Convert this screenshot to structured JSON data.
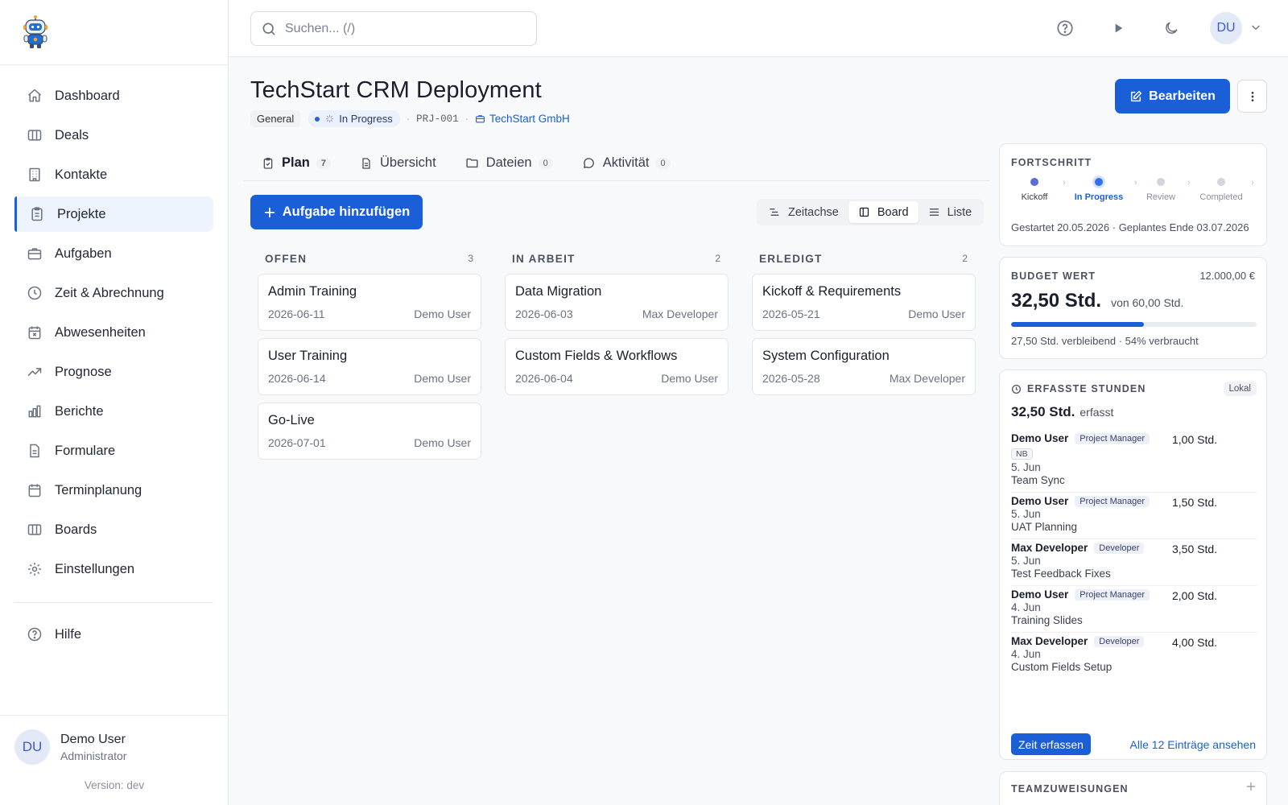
{
  "app": {
    "version_label": "Version: dev"
  },
  "sidebar": {
    "items": [
      {
        "label": "Dashboard",
        "icon": "home-icon"
      },
      {
        "label": "Deals",
        "icon": "columns-icon"
      },
      {
        "label": "Kontakte",
        "icon": "building-icon"
      },
      {
        "label": "Projekte",
        "icon": "clipboard-icon",
        "active": true
      },
      {
        "label": "Aufgaben",
        "icon": "briefcase-icon"
      },
      {
        "label": "Zeit & Abrechnung",
        "icon": "clock-icon"
      },
      {
        "label": "Abwesenheiten",
        "icon": "calendar-x-icon"
      },
      {
        "label": "Prognose",
        "icon": "trending-up-icon"
      },
      {
        "label": "Berichte",
        "icon": "bar-chart-icon"
      },
      {
        "label": "Formulare",
        "icon": "file-icon"
      },
      {
        "label": "Terminplanung",
        "icon": "calendar-icon"
      },
      {
        "label": "Boards",
        "icon": "columns-icon"
      },
      {
        "label": "Einstellungen",
        "icon": "gear-icon"
      }
    ],
    "help_label": "Hilfe",
    "user": {
      "initials": "DU",
      "name": "Demo User",
      "role": "Administrator"
    }
  },
  "topbar": {
    "search_placeholder": "Suchen... (/)",
    "avatar_initials": "DU"
  },
  "project": {
    "title": "TechStart CRM Deployment",
    "tag": "General",
    "status": "In Progress",
    "code": "PRJ-001",
    "company": "TechStart GmbH",
    "edit_label": "Bearbeiten"
  },
  "tabs": [
    {
      "label": "Plan",
      "count": "7",
      "active": true
    },
    {
      "label": "Übersicht",
      "count": ""
    },
    {
      "label": "Dateien",
      "count": "0"
    },
    {
      "label": "Aktivität",
      "count": "0"
    }
  ],
  "toolbar": {
    "add_label": "Aufgabe hinzufügen",
    "views": [
      {
        "label": "Zeitachse",
        "active": false
      },
      {
        "label": "Board",
        "active": true
      },
      {
        "label": "Liste",
        "active": false
      }
    ]
  },
  "board": {
    "columns": [
      {
        "title": "OFFEN",
        "count": "3",
        "cards": [
          {
            "title": "Admin Training",
            "date": "2026-06-11",
            "assignee": "Demo User"
          },
          {
            "title": "User Training",
            "date": "2026-06-14",
            "assignee": "Demo User"
          },
          {
            "title": "Go-Live",
            "date": "2026-07-01",
            "assignee": "Demo User"
          }
        ]
      },
      {
        "title": "IN ARBEIT",
        "count": "2",
        "cards": [
          {
            "title": "Data Migration",
            "date": "2026-06-03",
            "assignee": "Max Developer"
          },
          {
            "title": "Custom Fields & Workflows",
            "date": "2026-06-04",
            "assignee": "Demo User"
          }
        ]
      },
      {
        "title": "ERLEDIGT",
        "count": "2",
        "cards": [
          {
            "title": "Kickoff & Requirements",
            "date": "2026-05-21",
            "assignee": "Demo User"
          },
          {
            "title": "System Configuration",
            "date": "2026-05-28",
            "assignee": "Max Developer"
          }
        ]
      }
    ]
  },
  "progress": {
    "label": "FORTSCHRITT",
    "steps": [
      {
        "label": "Kickoff",
        "state": "done"
      },
      {
        "label": "In Progress",
        "state": "current"
      },
      {
        "label": "Review",
        "state": "todo"
      },
      {
        "label": "Completed",
        "state": "todo"
      }
    ],
    "dates": "Gestartet 20.05.2026 · Geplantes Ende 03.07.2026"
  },
  "budget": {
    "label": "BUDGET WERT",
    "amount": "12.000,00 €",
    "used": "32,50 Std.",
    "of": "von 60,00 Std.",
    "used_fraction": 0.54,
    "footer": "27,50 Std. verbleibend · 54% verbraucht"
  },
  "hours": {
    "label": "ERFASSTE STUNDEN",
    "badge": "Lokal",
    "total": "32,50 Std.",
    "total_suffix": "erfasst",
    "entries": [
      {
        "name": "Demo User",
        "role": "Project Manager",
        "hours": "1,00 Std.",
        "flag": "NB",
        "date": "5. Jun",
        "desc": "Team Sync"
      },
      {
        "name": "Demo User",
        "role": "Project Manager",
        "hours": "1,50 Std.",
        "flag": "",
        "date": "5. Jun",
        "desc": "UAT Planning"
      },
      {
        "name": "Max Developer",
        "role": "Developer",
        "hours": "3,50 Std.",
        "flag": "",
        "date": "5. Jun",
        "desc": "Test Feedback Fixes"
      },
      {
        "name": "Demo User",
        "role": "Project Manager",
        "hours": "2,00 Std.",
        "flag": "",
        "date": "4. Jun",
        "desc": "Training Slides"
      },
      {
        "name": "Max Developer",
        "role": "Developer",
        "hours": "4,00 Std.",
        "flag": "",
        "date": "4. Jun",
        "desc": "Custom Fields Setup"
      }
    ],
    "log_label": "Zeit erfassen",
    "all_label": "Alle 12 Einträge ansehen"
  },
  "team": {
    "label": "TEAMZUWEISUNGEN"
  }
}
